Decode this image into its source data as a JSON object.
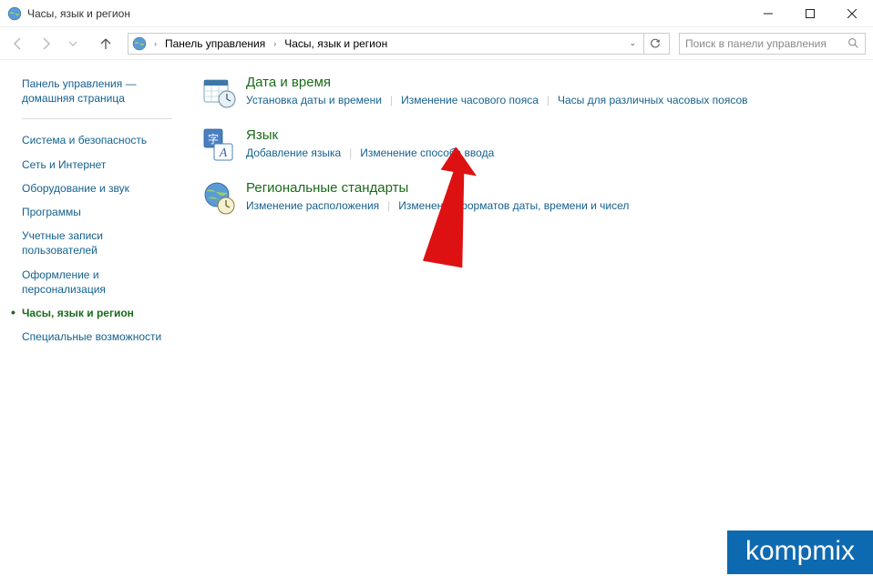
{
  "window": {
    "title": "Часы, язык и регион"
  },
  "nav": {
    "breadcrumb": {
      "root": "Панель управления",
      "current": "Часы, язык и регион"
    },
    "search_placeholder": "Поиск в панели управления"
  },
  "sidebar": {
    "home": "Панель управления — домашняя страница",
    "items": [
      "Система и безопасность",
      "Сеть и Интернет",
      "Оборудование и звук",
      "Программы",
      "Учетные записи пользователей",
      "Оформление и персонализация",
      "Часы, язык и регион",
      "Специальные возможности"
    ],
    "active_index": 6
  },
  "categories": [
    {
      "title": "Дата и время",
      "links": [
        "Установка даты и времени",
        "Изменение часового пояса",
        "Часы для различных часовых поясов"
      ]
    },
    {
      "title": "Язык",
      "links": [
        "Добавление языка",
        "Изменение способа ввода"
      ]
    },
    {
      "title": "Региональные стандарты",
      "links": [
        "Изменение расположения",
        "Изменение форматов даты, времени и чисел"
      ]
    }
  ],
  "watermark": "kompmix"
}
